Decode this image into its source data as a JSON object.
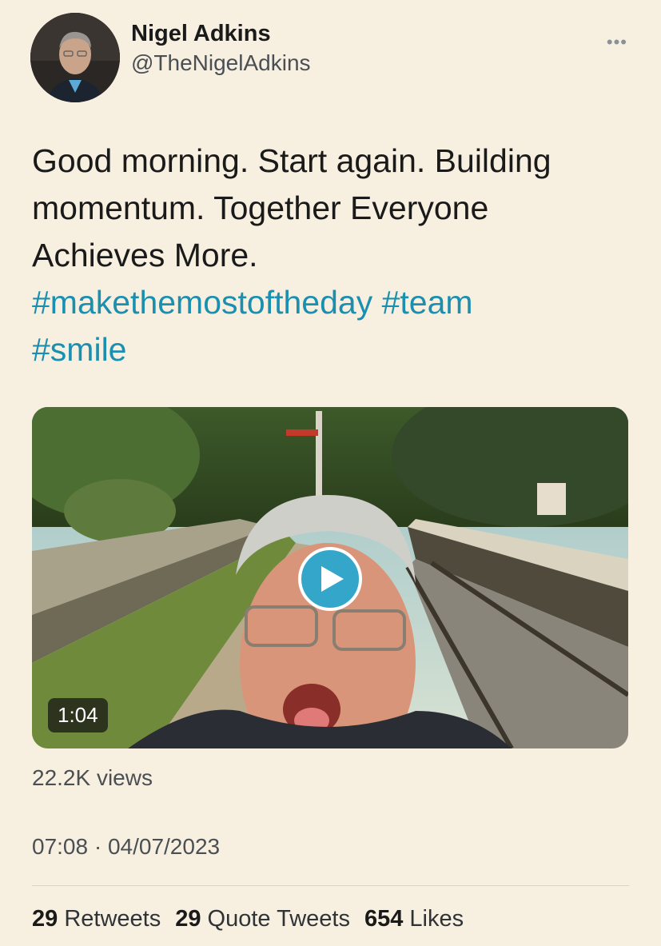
{
  "author": {
    "display_name": "Nigel Adkins",
    "handle": "@TheNigelAdkins",
    "avatar_icon": "avatar-photo"
  },
  "menu_icon": "more-options-icon",
  "tweet": {
    "text_line1": "Good morning. Start again. Building",
    "text_line2": "momentum. Together Everyone",
    "text_line3": "Achieves More.",
    "hashtags": [
      "#makethemostoftheday",
      "#team",
      "#smile"
    ]
  },
  "media": {
    "type": "video",
    "duration": "1:04",
    "play_icon": "play-icon"
  },
  "views": "22.2K views",
  "timestamp": "07:08 · 04/07/2023",
  "stats": {
    "retweets_count": "29",
    "retweets_label": "Retweets",
    "quotes_count": "29",
    "quotes_label": "Quote Tweets",
    "likes_count": "654",
    "likes_label": "Likes"
  },
  "colors": {
    "background": "#f7efe0",
    "hashtag": "#1b8fb0",
    "play_button": "#34a6c9"
  }
}
